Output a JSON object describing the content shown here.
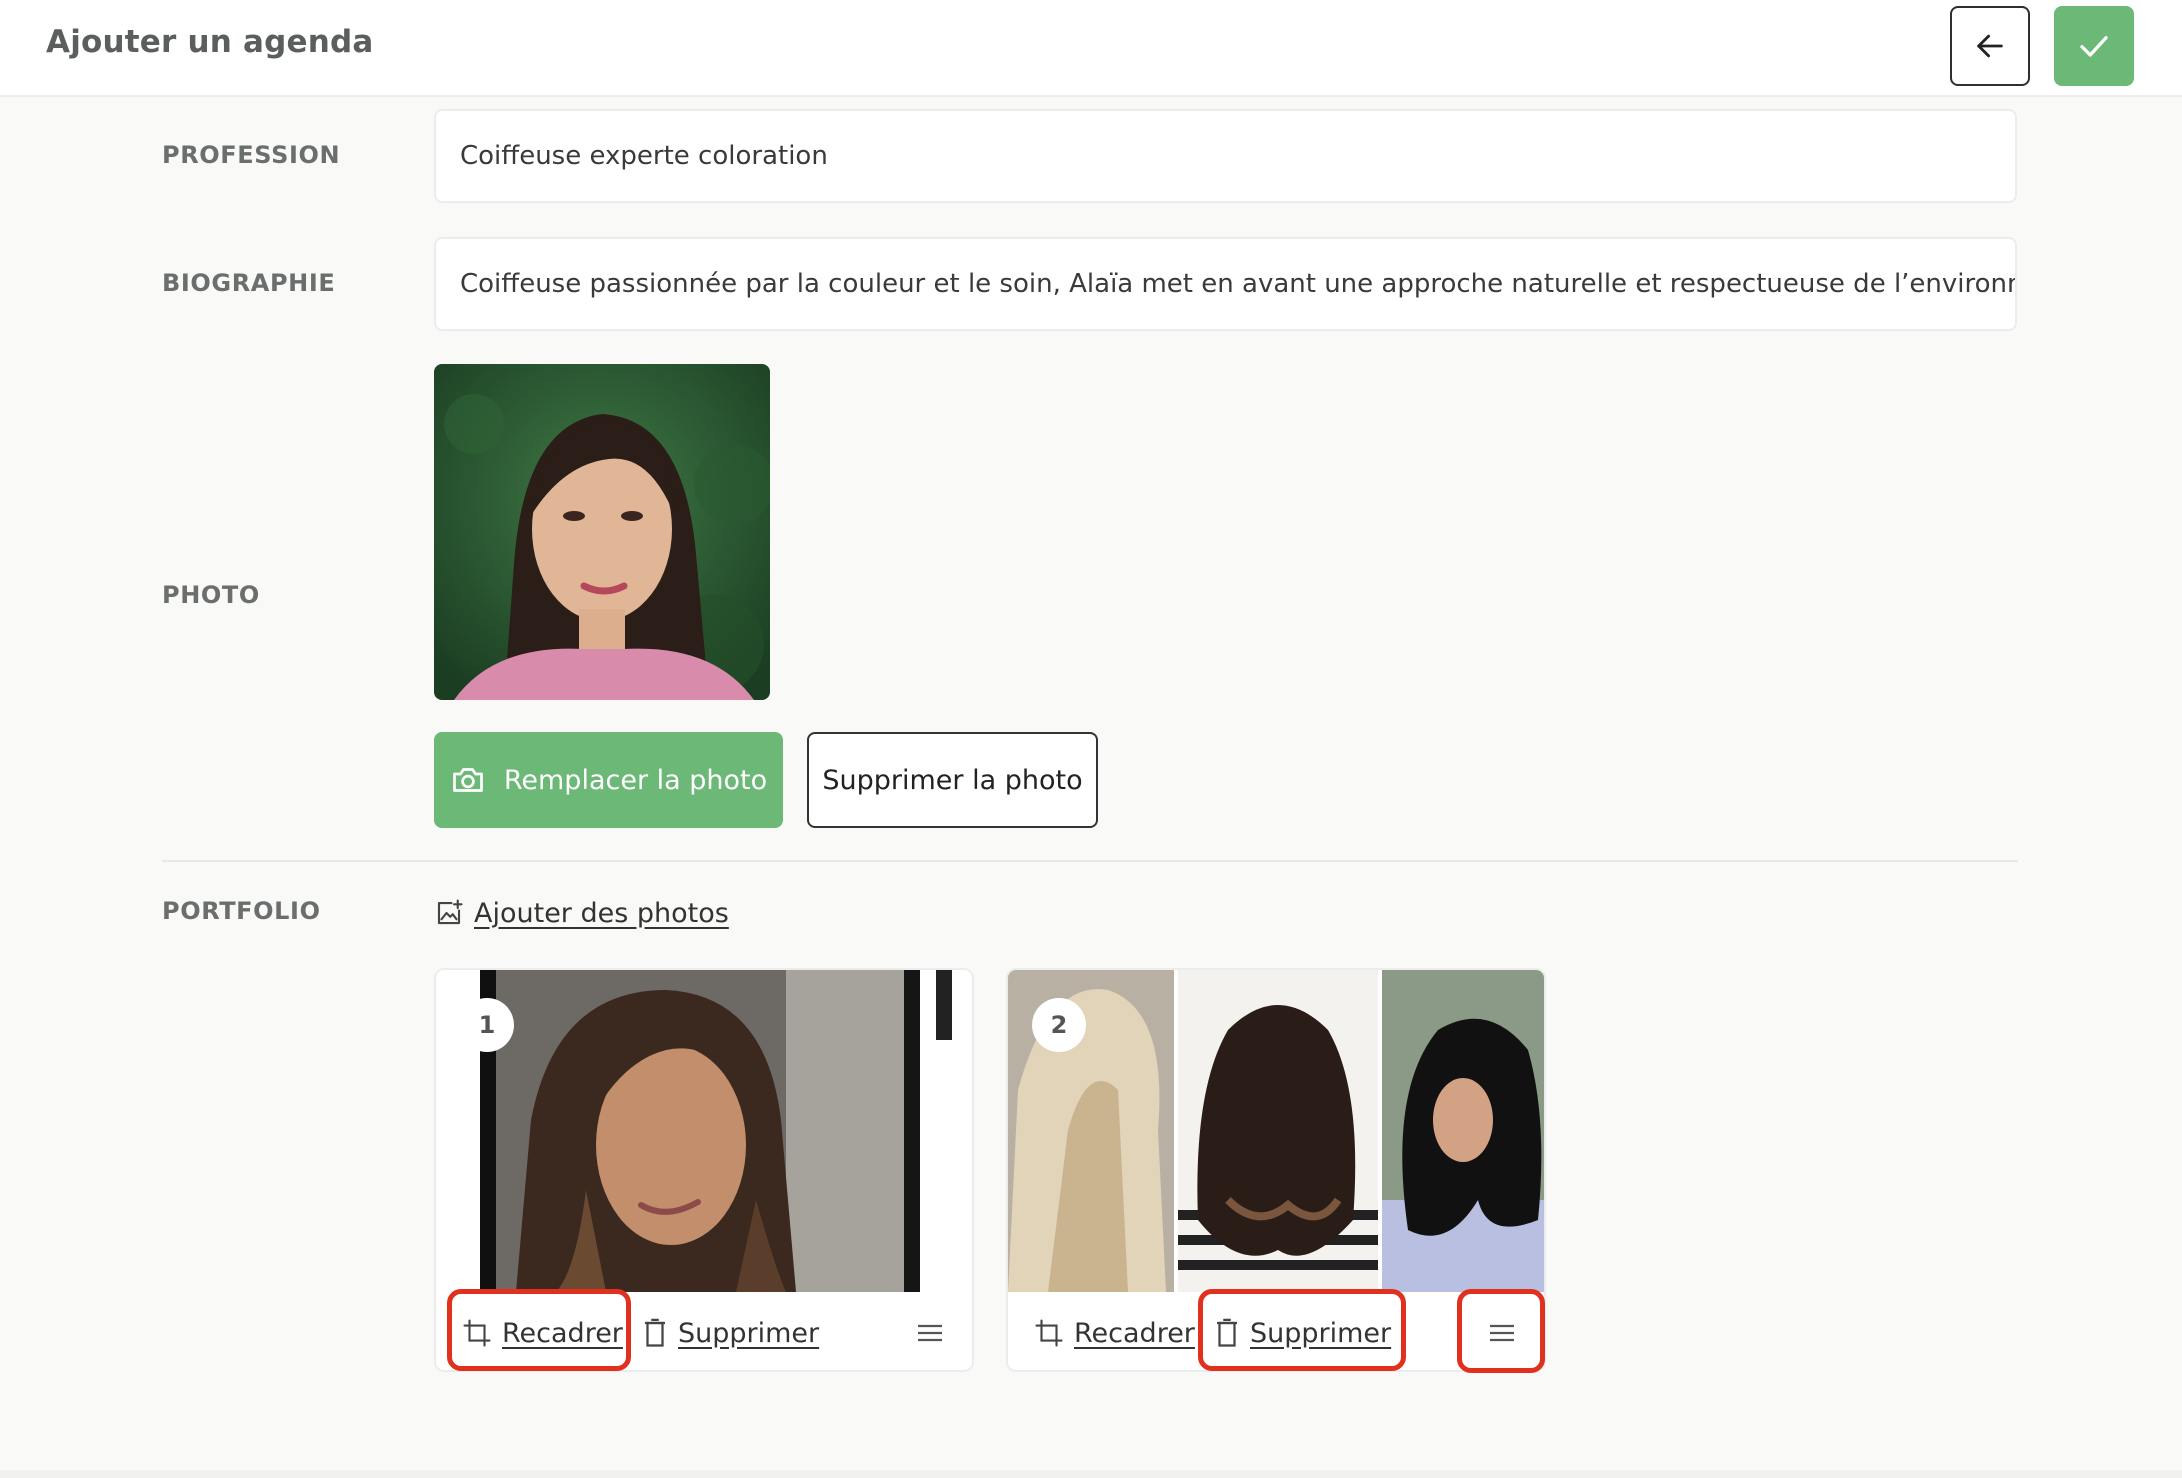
{
  "header": {
    "title": "Ajouter un agenda",
    "back_icon": "arrow-left-icon",
    "confirm_icon": "check-icon",
    "accent_color": "#6cb877"
  },
  "fields": {
    "profession": {
      "label": "PROFESSION",
      "value": "Coiffeuse experte coloration"
    },
    "biography": {
      "label": "BIOGRAPHIE",
      "value": "Coiffeuse passionnée par la couleur et le soin, Alaïa met en avant une approche naturelle et respectueuse de l’environnement."
    },
    "photo": {
      "label": "PHOTO",
      "replace_label": "Remplacer la photo",
      "replace_icon": "camera-icon",
      "delete_label": "Supprimer la photo"
    }
  },
  "portfolio": {
    "label": "PORTFOLIO",
    "add_label": "Ajouter des photos",
    "add_icon": "add-image-icon",
    "items": [
      {
        "index": "1",
        "crop_label": "Recadrer",
        "delete_label": "Supprimer",
        "crop_icon": "crop-icon",
        "delete_icon": "trash-icon",
        "handle_icon": "drag-handle-icon"
      },
      {
        "index": "2",
        "crop_label": "Recadrer",
        "delete_label": "Supprimer",
        "crop_icon": "crop-icon",
        "delete_icon": "trash-icon",
        "handle_icon": "drag-handle-icon"
      }
    ]
  },
  "highlight_color": "#e0301e"
}
